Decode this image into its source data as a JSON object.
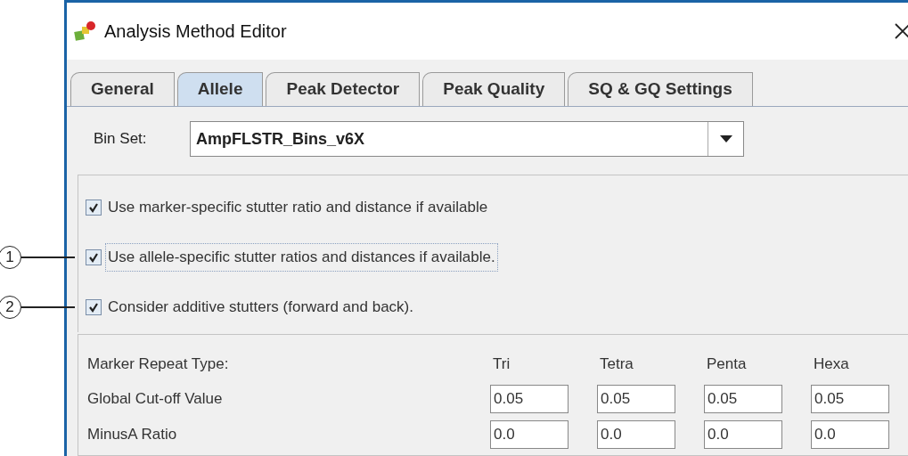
{
  "window": {
    "title": "Analysis Method Editor"
  },
  "tabs": [
    {
      "label": "General",
      "selected": false
    },
    {
      "label": "Allele",
      "selected": true
    },
    {
      "label": "Peak Detector",
      "selected": false
    },
    {
      "label": "Peak Quality",
      "selected": false
    },
    {
      "label": "SQ & GQ Settings",
      "selected": false
    }
  ],
  "bin_set": {
    "label": "Bin Set:",
    "value": "AmpFLSTR_Bins_v6X"
  },
  "options": [
    {
      "label": "Use marker-specific stutter ratio and distance if available",
      "checked": true,
      "focused": false
    },
    {
      "label": "Use allele-specific stutter ratios and distances if available.",
      "checked": true,
      "focused": true,
      "callout": "1"
    },
    {
      "label": "Consider additive stutters (forward and back).",
      "checked": true,
      "focused": false,
      "callout": "2"
    }
  ],
  "table": {
    "header": "Marker Repeat Type:",
    "columns": [
      "Tri",
      "Tetra",
      "Penta",
      "Hexa"
    ],
    "rows": [
      {
        "label": "Global Cut-off Value",
        "values": [
          "0.05",
          "0.05",
          "0.05",
          "0.05"
        ]
      },
      {
        "label": "MinusA Ratio",
        "values": [
          "0.0",
          "0.0",
          "0.0",
          "0.0"
        ]
      }
    ]
  }
}
